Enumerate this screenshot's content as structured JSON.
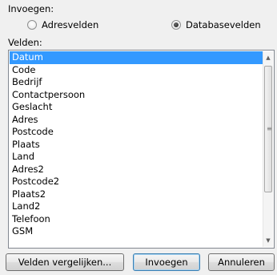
{
  "insert_group": {
    "label": "Invoegen:",
    "options": [
      {
        "label": "Adresvelden",
        "accesskey": "A",
        "checked": false
      },
      {
        "label": "Databasevelden",
        "accesskey": "D",
        "checked": true
      }
    ]
  },
  "fields": {
    "label": "Velden:",
    "items": [
      "Datum",
      "Code",
      "Bedrijf",
      "Contactpersoon",
      "Geslacht",
      "Adres",
      "Postcode",
      "Plaats",
      "Land",
      "Adres2",
      "Postcode2",
      "Plaats2",
      "Land2",
      "Telefoon",
      "GSM"
    ],
    "selected_index": 0
  },
  "buttons": {
    "compare": "Velden vergelijken...",
    "insert": "Invoegen",
    "cancel": "Annuleren"
  },
  "colors": {
    "selection": "#3399ff",
    "dialog_background": "#f0f0f0"
  }
}
